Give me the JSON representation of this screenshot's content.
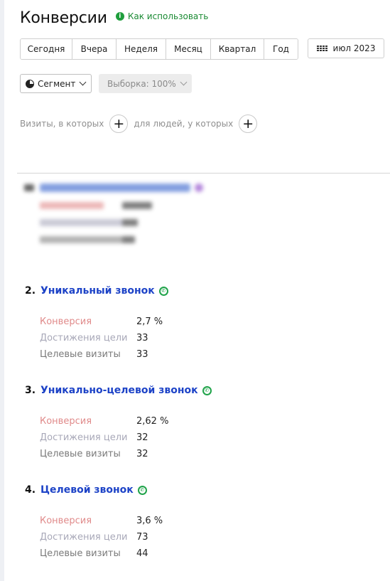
{
  "header": {
    "title": "Конверсии",
    "how_to_label": "Как использовать"
  },
  "period": {
    "buttons": [
      "Сегодня",
      "Вчера",
      "Неделя",
      "Месяц",
      "Квартал",
      "Год"
    ],
    "date_label": "июл 2023"
  },
  "filters": {
    "segment_label": "Сегмент",
    "sample_label": "Выборка: 100%",
    "visits_text": "Визиты, в которых",
    "people_text": "для людей, у которых",
    "plus_symbol": "+"
  },
  "goals": [
    {
      "number": "2.",
      "name": "Уникальный звонок",
      "stats": [
        {
          "label": "Конверсия",
          "value": "2,7 %"
        },
        {
          "label": "Достижения цели",
          "value": "33"
        },
        {
          "label": "Целевые визиты",
          "value": "33"
        }
      ]
    },
    {
      "number": "3.",
      "name": "Уникально-целевой звонок",
      "stats": [
        {
          "label": "Конверсия",
          "value": "2,62 %"
        },
        {
          "label": "Достижения цели",
          "value": "32"
        },
        {
          "label": "Целевые визиты",
          "value": "32"
        }
      ]
    },
    {
      "number": "4.",
      "name": "Целевой звонок",
      "stats": [
        {
          "label": "Конверсия",
          "value": "3,6 %"
        },
        {
          "label": "Достижения цели",
          "value": "73"
        },
        {
          "label": "Целевые визиты",
          "value": "44"
        }
      ]
    }
  ],
  "colors": {
    "goal_link": "#1d43c7",
    "accent_green": "#1e9e3c",
    "conversion_label": "#e08a8a"
  }
}
